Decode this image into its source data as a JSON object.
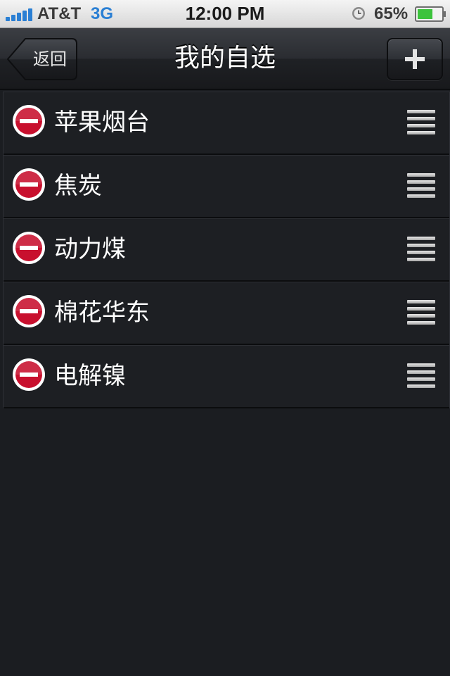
{
  "status_bar": {
    "carrier": "AT&T",
    "network": "3G",
    "time": "12:00 PM",
    "battery": "65%",
    "icons": [
      "signal-bars-icon",
      "alarm-clock-icon",
      "battery-icon"
    ],
    "signal_color": "#2a7fd4",
    "battery_level": 0.65
  },
  "nav": {
    "back_label": "返回",
    "title": "我的自选",
    "add_icon": "plus-icon"
  },
  "list": {
    "items": [
      {
        "label": "苹果烟台"
      },
      {
        "label": "焦炭"
      },
      {
        "label": "动力煤"
      },
      {
        "label": "棉花华东"
      },
      {
        "label": "电解镍"
      }
    ],
    "delete_icon": "minus-circle-icon",
    "reorder_icon": "reorder-grip-icon",
    "delete_color": "#c8102e"
  }
}
